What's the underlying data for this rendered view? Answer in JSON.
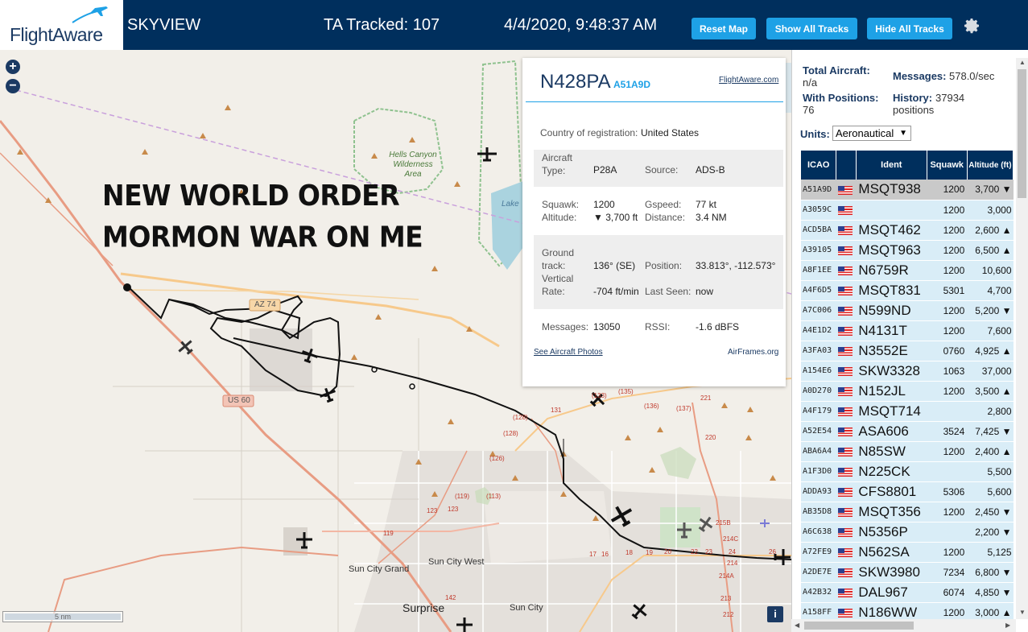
{
  "header": {
    "logo_text": "FlightAware",
    "app_name": "SKYVIEW",
    "tracked_label": "TA Tracked: 107",
    "datetime": "4/4/2020, 9:48:37 AM",
    "buttons": {
      "reset": "Reset Map",
      "show_all": "Show All Tracks",
      "hide_all": "Hide All Tracks"
    }
  },
  "map": {
    "overlay_line1": "NEW WORLD ORDER",
    "overlay_line2": "MORMON WAR ON ME",
    "labels": {
      "hells_canyon": "Hells Canyon Wilderness Area",
      "az74": "AZ 74",
      "us60": "US 60",
      "sun_city_west": "Sun City West",
      "sun_city_grand": "Sun City Grand",
      "surprise": "Surprise",
      "sun_city": "Sun City",
      "lake": "Lake",
      "scale": "5 nm"
    },
    "route_numbers": [
      "(133)",
      "(135)",
      "(136)",
      "(137)",
      "131",
      "(128)",
      "(128)",
      "(126)",
      "(119)",
      "(113)",
      "123",
      "123",
      "119",
      "142",
      "17",
      "16",
      "18",
      "19",
      "20",
      "22",
      "23",
      "24",
      "26",
      "221",
      "220",
      "215B",
      "214C",
      "214",
      "214A",
      "213",
      "212"
    ],
    "info_label": "i"
  },
  "popup": {
    "registration": "N428PA",
    "hex": "A51A9D",
    "fa_link": "FlightAware.com",
    "country_label": "Country of registration:",
    "country_value": "United States",
    "aircraft_type_label": "Aircraft Type:",
    "aircraft_type": "P28A",
    "source_label": "Source:",
    "source": "ADS-B",
    "squawk_label": "Squawk:",
    "squawk": "1200",
    "gspeed_label": "Gspeed:",
    "gspeed": "77 kt",
    "altitude_label": "Altitude:",
    "altitude": "▼ 3,700 ft",
    "distance_label": "Distance:",
    "distance": "3.4 NM",
    "ground_track_label": "Ground track:",
    "ground_track": "136° (SE)",
    "position_label": "Position:",
    "position": "33.813°, -112.573°",
    "vrate_label": "Vertical Rate:",
    "vrate": "-704 ft/min",
    "last_seen_label": "Last Seen:",
    "last_seen": "now",
    "messages_label": "Messages:",
    "messages": "13050",
    "rssi_label": "RSSI:",
    "rssi": "-1.6 dBFS",
    "photos_link": "See Aircraft Photos",
    "airframes_link": "AirFrames.org"
  },
  "sidebar": {
    "total_label": "Total Aircraft:",
    "total_value": "n/a",
    "messages_label": "Messages:",
    "messages_value": "578.0/sec",
    "positions_label": "With Positions:",
    "positions_value": "76",
    "history_label": "History:",
    "history_value": "37934",
    "history_unit": "positions",
    "units_label": "Units:",
    "units_value": "Aeronautical",
    "columns": [
      "ICAO",
      "Ident",
      "Squawk",
      "Altitude (ft)"
    ],
    "rows": [
      {
        "icao": "A51A9D",
        "ident": "MSQT938",
        "squawk": "1200",
        "alt": "3,700 ▼"
      },
      {
        "icao": "A3059C",
        "ident": "",
        "squawk": "1200",
        "alt": "3,000"
      },
      {
        "icao": "ACD5BA",
        "ident": "MSQT462",
        "squawk": "1200",
        "alt": "2,600 ▲"
      },
      {
        "icao": "A39105",
        "ident": "MSQT963",
        "squawk": "1200",
        "alt": "6,500 ▲"
      },
      {
        "icao": "A8F1EE",
        "ident": "N6759R",
        "squawk": "1200",
        "alt": "10,600"
      },
      {
        "icao": "A4F6D5",
        "ident": "MSQT831",
        "squawk": "5301",
        "alt": "4,700"
      },
      {
        "icao": "A7C006",
        "ident": "N599ND",
        "squawk": "1200",
        "alt": "5,200 ▼"
      },
      {
        "icao": "A4E1D2",
        "ident": "N4131T",
        "squawk": "1200",
        "alt": "7,600"
      },
      {
        "icao": "A3FA03",
        "ident": "N3552E",
        "squawk": "0760",
        "alt": "4,925 ▲"
      },
      {
        "icao": "A154E6",
        "ident": "SKW3328",
        "squawk": "1063",
        "alt": "37,000"
      },
      {
        "icao": "A0D270",
        "ident": "N152JL",
        "squawk": "1200",
        "alt": "3,500 ▲"
      },
      {
        "icao": "A4F179",
        "ident": "MSQT714",
        "squawk": "",
        "alt": "2,800"
      },
      {
        "icao": "A52E54",
        "ident": "ASA606",
        "squawk": "3524",
        "alt": "7,425 ▼"
      },
      {
        "icao": "ABA6A4",
        "ident": "N85SW",
        "squawk": "1200",
        "alt": "2,400 ▲"
      },
      {
        "icao": "A1F3D0",
        "ident": "N225CK",
        "squawk": "",
        "alt": "5,500"
      },
      {
        "icao": "ADDA93",
        "ident": "CFS8801",
        "squawk": "5306",
        "alt": "5,600"
      },
      {
        "icao": "AB35D8",
        "ident": "MSQT356",
        "squawk": "1200",
        "alt": "2,450 ▼"
      },
      {
        "icao": "A6C638",
        "ident": "N5356P",
        "squawk": "",
        "alt": "2,200 ▼"
      },
      {
        "icao": "A72FE9",
        "ident": "N562SA",
        "squawk": "1200",
        "alt": "5,125"
      },
      {
        "icao": "A2DE7E",
        "ident": "SKW3980",
        "squawk": "7234",
        "alt": "6,800 ▼"
      },
      {
        "icao": "A42B32",
        "ident": "DAL967",
        "squawk": "6074",
        "alt": "4,850 ▼"
      },
      {
        "icao": "A158FF",
        "ident": "N186WW",
        "squawk": "1200",
        "alt": "3,000 ▲"
      }
    ]
  },
  "colors": {
    "header_bg": "#002f5d",
    "button": "#1ea1e6",
    "table_header": "#002f5d",
    "table_row": "#d9edf7",
    "selected_row": "#c9c9c9"
  }
}
